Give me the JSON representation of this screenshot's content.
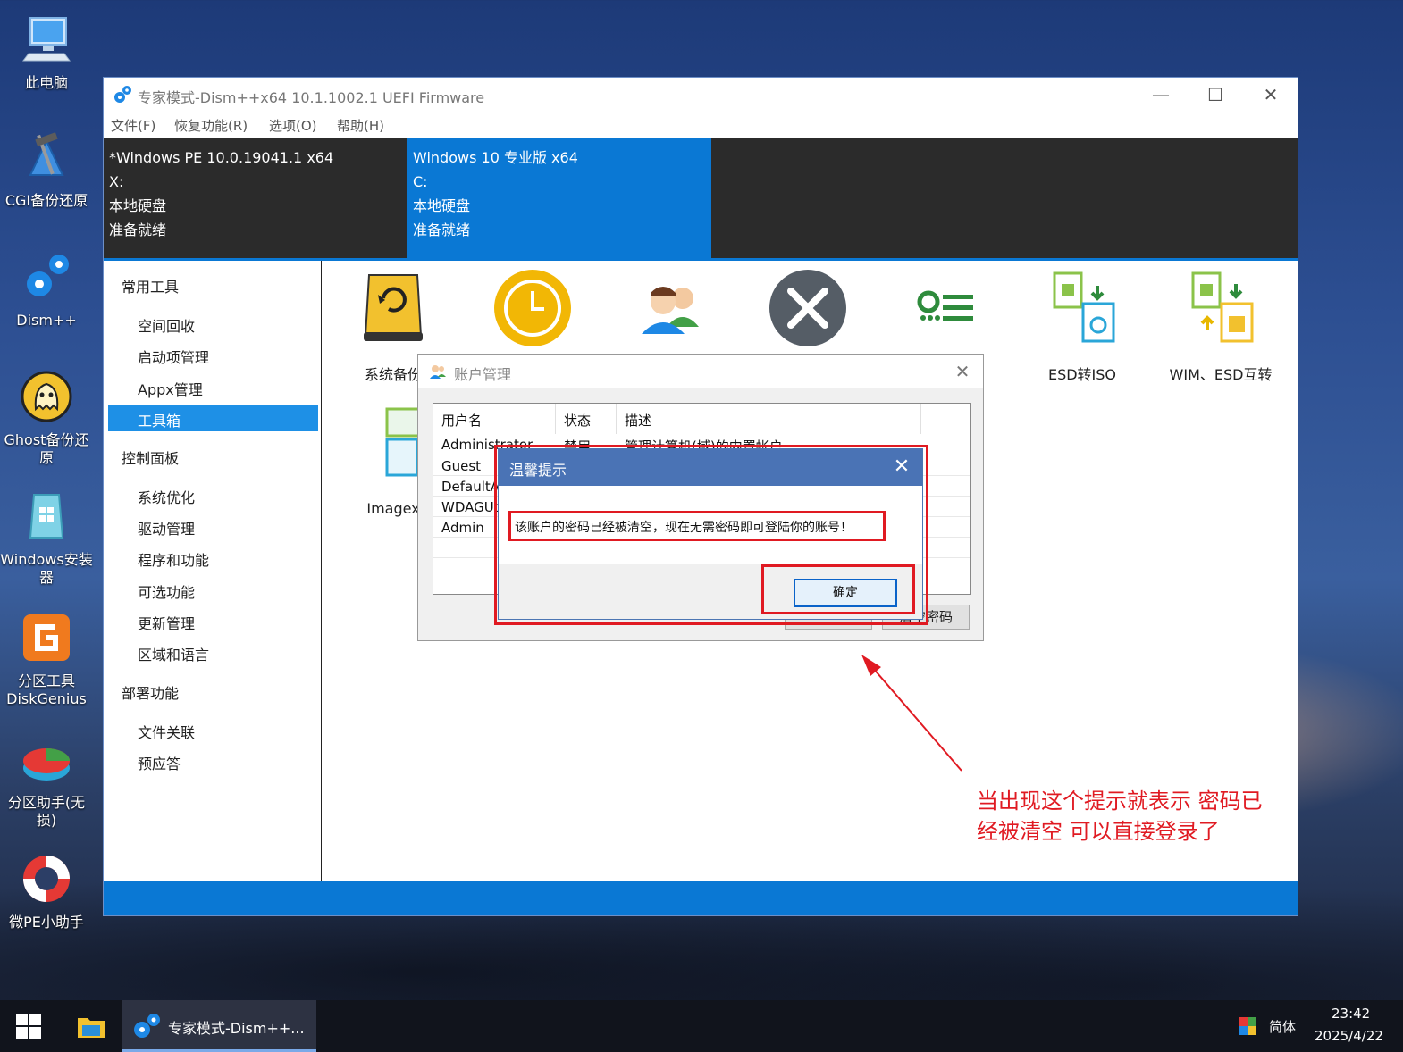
{
  "desktop": {
    "icons": [
      {
        "label": "此电脑",
        "icon": "computer-icon"
      },
      {
        "label": "CGI备份还原",
        "icon": "cgi-backup-icon"
      },
      {
        "label": "Dism++",
        "icon": "dism-gear-icon"
      },
      {
        "label": "Ghost备份还原",
        "icon": "ghost-icon"
      },
      {
        "label": "Windows安装器",
        "icon": "windows-installer-icon"
      },
      {
        "label": "分区工具DiskGenius",
        "icon": "diskgenius-icon"
      },
      {
        "label": "分区助手(无损)",
        "icon": "partition-assistant-icon"
      },
      {
        "label": "微PE小助手",
        "icon": "lifebuoy-icon"
      }
    ]
  },
  "window": {
    "title": "专家模式-Dism++x64 10.1.1002.1 UEFI Firmware",
    "menu": [
      "文件(F)",
      "恢复功能(R)",
      "选项(O)",
      "帮助(H)"
    ],
    "images": [
      {
        "lines": [
          "*Windows PE 10.0.19041.1 x64",
          "X:",
          "本地硬盘",
          "准备就绪"
        ],
        "selected": false
      },
      {
        "lines": [
          "Windows 10 专业版 x64",
          "C:",
          "本地硬盘",
          "准备就绪"
        ],
        "selected": true
      }
    ],
    "sidebar": {
      "group_common": "常用工具",
      "common_items": [
        "空间回收",
        "启动项管理",
        "Appx管理",
        "工具箱"
      ],
      "selected_item": "工具箱",
      "group_control": "控制面板",
      "control_items": [
        "系统优化",
        "驱动管理",
        "程序和功能",
        "可选功能",
        "更新管理",
        "区域和语言"
      ],
      "group_deploy": "部署功能",
      "deploy_items": [
        "文件关联",
        "预应答"
      ]
    },
    "tools": [
      {
        "label": "系统备份",
        "icon": "system-backup-icon"
      },
      {
        "label": "",
        "icon": "clock-restore-icon"
      },
      {
        "label": "",
        "icon": "users-icon"
      },
      {
        "label": "",
        "icon": "tools-icon"
      },
      {
        "label": "",
        "icon": "settings-list-icon"
      },
      {
        "label": "ESD转ISO",
        "icon": "esd-to-iso-icon"
      },
      {
        "label": "WIM、ESD互转",
        "icon": "wim-esd-convert-icon"
      },
      {
        "label": "Imagex",
        "icon": "imagex-icon"
      }
    ]
  },
  "account_dialog": {
    "title": "账户管理",
    "columns": [
      "用户名",
      "状态",
      "描述"
    ],
    "rows": [
      {
        "name": "Administrator",
        "status": "禁用",
        "desc": "管理计算机(域)的内置帐户"
      },
      {
        "name": "Guest",
        "status": "",
        "desc": ""
      },
      {
        "name": "DefaultAc",
        "status": "",
        "desc": ""
      },
      {
        "name": "WDAGUti",
        "status": "",
        "desc": ""
      },
      {
        "name": "Admin",
        "status": "",
        "desc": ""
      }
    ],
    "buttons": [
      "清空密码"
    ]
  },
  "tip_dialog": {
    "title": "温馨提示",
    "message": "该账户的密码已经被清空，现在无需密码即可登陆你的账号！",
    "ok_label": "确定"
  },
  "annotation": {
    "text": "当出现这个提示就表示 密码已经被清空 可以直接登录了",
    "color": "#e01a22"
  },
  "taskbar": {
    "app_label": "专家模式-Dism++...",
    "ime": "简体",
    "time": "23:42",
    "date": "2025/4/22"
  },
  "colors": {
    "accent": "#0a78d4",
    "sidebar_selected": "#1e90e6",
    "annotation_red": "#e01a22"
  }
}
